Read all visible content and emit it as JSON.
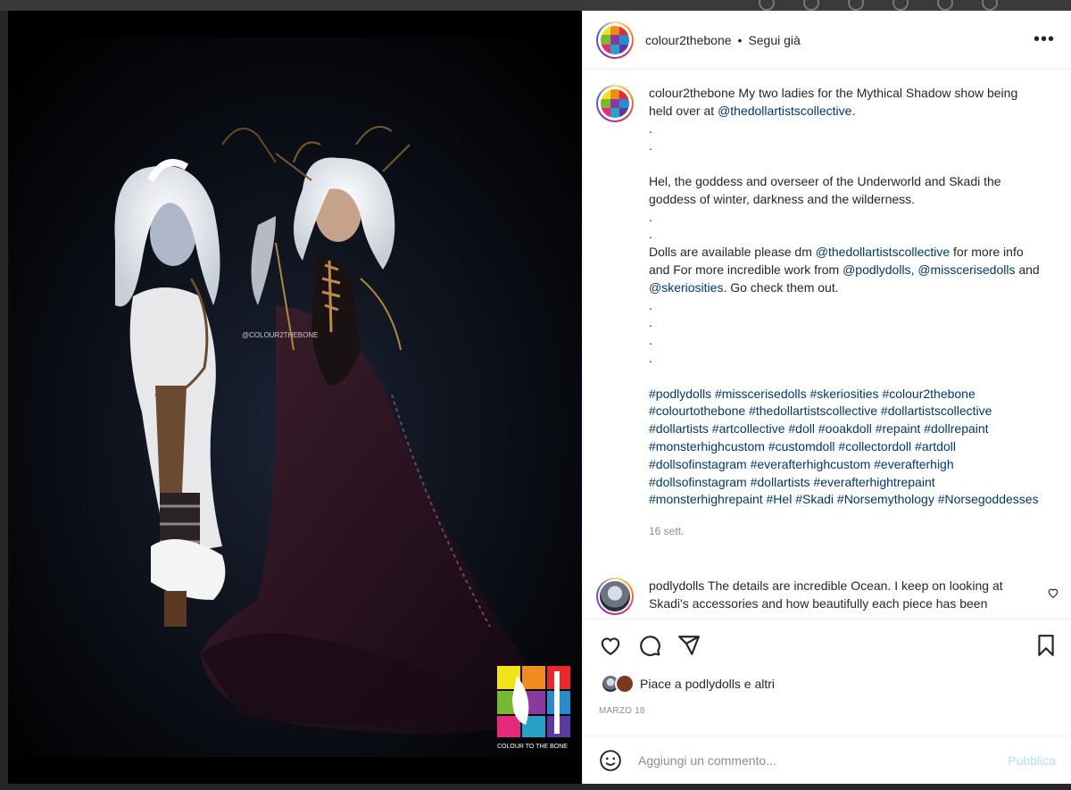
{
  "post": {
    "username": "colour2thebone",
    "follow_status": "Segui già",
    "separator": "•",
    "more_icon": "more-horizontal-icon",
    "caption": {
      "username": "colour2thebone",
      "line1_a": "My two ladies for the Mythical Shadow show being held over at ",
      "line1_mention": "@thedollartistscollective",
      "line1_b": ".",
      "para2": "Hel, the goddess and overseer of the Underworld and Skadi the goddess of winter, darkness and the wilderness.",
      "para3_a": "Dolls are available please dm ",
      "para3_m1": "@thedollartistscollective",
      "para3_b": " for more info and For more incredible work from ",
      "para3_m2": "@podlydolls",
      "para3_c": ", ",
      "para3_m3": "@misscerisedolls",
      "para3_d": " and ",
      "para3_m4": "@skeriosities",
      "para3_e": ". Go check them out.",
      "dot": ".",
      "hashtags": "#podlydolls #misscerisedolls #skeriosities #colour2thebone #colourtothebone #thedollartistscollective #dollartistscollective #dollartists #artcollective #doll #ooakdoll #repaint #dollrepaint #monsterhighcustom #customdoll #collectordoll #artdoll #dollsofinstagram #everafterhighcustom #everafterhigh #dollsofinstagram #dollartists #everafterhightrepaint #monsterhighrepaint #Hel #Skadi #Norsemythology #Norsegoddesses",
      "time": "16 sett."
    },
    "comment": {
      "username": "podlydolls",
      "text": "The details are incredible Ocean. I keep on looking at Skadi's accessories and how beautifully each piece has been"
    },
    "likes": {
      "prefix": "Piace a",
      "user": "podlydolls",
      "conj": "e",
      "others": "altri"
    },
    "date": "MARZO 18",
    "add_comment": {
      "placeholder": "Aggiungi un commento...",
      "publish": "Pubblica"
    }
  },
  "photo": {
    "watermark": "@COLOUR2THEBONE",
    "logo_caption": "COLOUR TO THE BONE"
  },
  "colors": {
    "link": "#00376b",
    "muted": "#8e8e8e",
    "publish_disabled": "#b2dffc"
  }
}
